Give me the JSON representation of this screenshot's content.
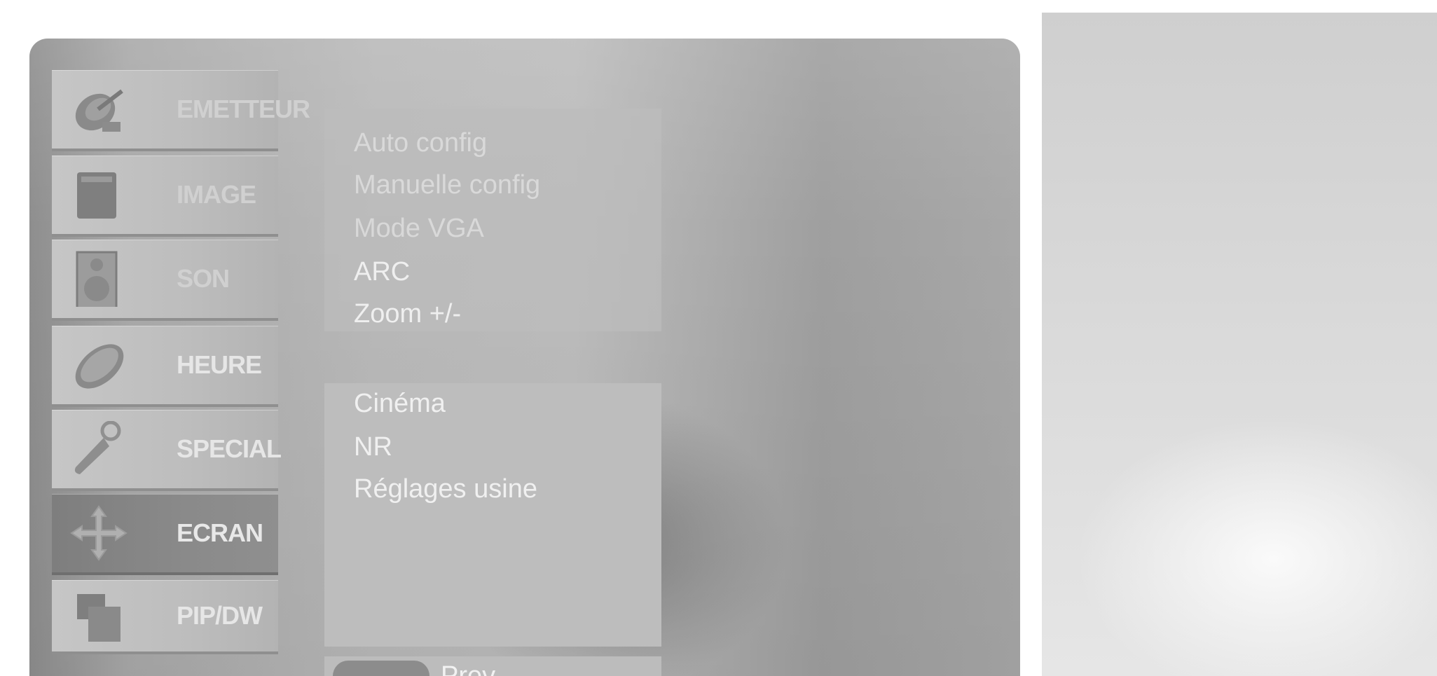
{
  "sidebar": {
    "tabs": [
      {
        "label": "EMETTEUR",
        "icon": "satellite-dish-icon"
      },
      {
        "label": "IMAGE",
        "icon": "picture-icon"
      },
      {
        "label": "SON",
        "icon": "speaker-icon"
      },
      {
        "label": "HEURE",
        "icon": "clock-icon"
      },
      {
        "label": "SPECIAL",
        "icon": "key-tag-icon"
      },
      {
        "label": "ECRAN",
        "icon": "move-arrows-icon",
        "selected": true
      },
      {
        "label": "PIP/DW",
        "icon": "picture-in-picture-icon"
      }
    ]
  },
  "submenu": {
    "upper_items": [
      "Auto config",
      "Manuelle config",
      "Mode VGA",
      "ARC",
      "Zoom +/-"
    ],
    "lower_items": [
      "Cinéma",
      "NR",
      "Réglages usine"
    ]
  },
  "footer": {
    "prev_label": "Prev."
  },
  "colors": {
    "panel": "#b5b5b5",
    "selected_tab": "#868686",
    "text": "#f0f0f0"
  }
}
